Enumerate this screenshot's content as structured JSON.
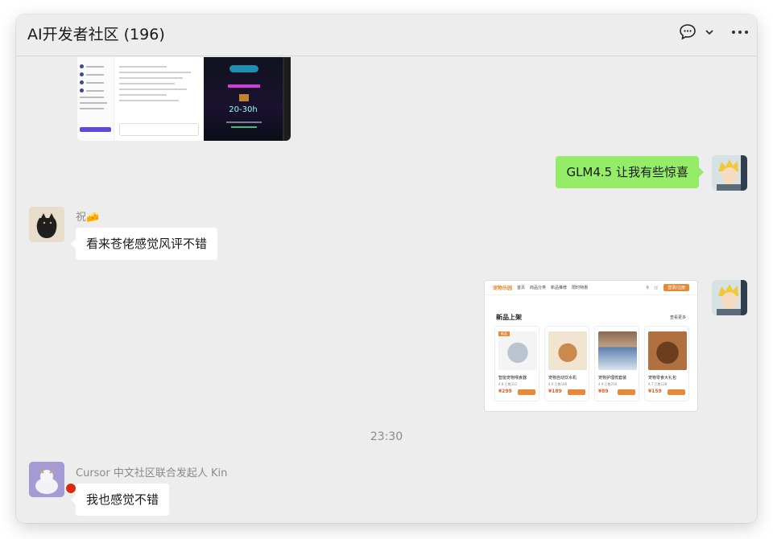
{
  "window": {
    "title": "AI开发者社区 (196)"
  },
  "header_icons": {
    "chat": "chat-bubble-icon",
    "chevron": "chevron-down-icon",
    "more": "more-dots-icon"
  },
  "messages": {
    "m1": {
      "text": "GLM4.5 让我有些惊喜",
      "side": "right"
    },
    "m2": {
      "sender": "祝🧀",
      "text": "看来苍佬感觉风评不错",
      "side": "left"
    },
    "m3": {
      "side": "right",
      "type": "image"
    },
    "time_divider": "23:30",
    "m4": {
      "sender": "Cursor 中文社区联合发起人 Kin",
      "text": "我也感觉不错",
      "side": "left"
    }
  },
  "thumb_top": {
    "hours": "20-30h"
  },
  "shot": {
    "logo": "宠物乐园",
    "nav": [
      "首页",
      "商品分类",
      "新品推荐",
      "限时特惠"
    ],
    "login": "登录/注册",
    "heading": "新品上架",
    "more": "查看更多",
    "cards": [
      {
        "name": "智能宠物喂食器",
        "rating": "4.8 已售312",
        "price": "¥299",
        "tag": "新品"
      },
      {
        "name": "宠物自动饮水机",
        "rating": "4.6 已售186",
        "price": "¥189"
      },
      {
        "name": "宠物护理梳套装",
        "rating": "4.9 已售256",
        "price": "¥89"
      },
      {
        "name": "宠物零食大礼包",
        "rating": "4.7 已售128",
        "price": "¥159"
      }
    ]
  },
  "colors": {
    "bubble_green": "#95ec69",
    "bubble_white": "#ffffff",
    "bg": "#ededed",
    "accent_orange": "#e8893a"
  }
}
